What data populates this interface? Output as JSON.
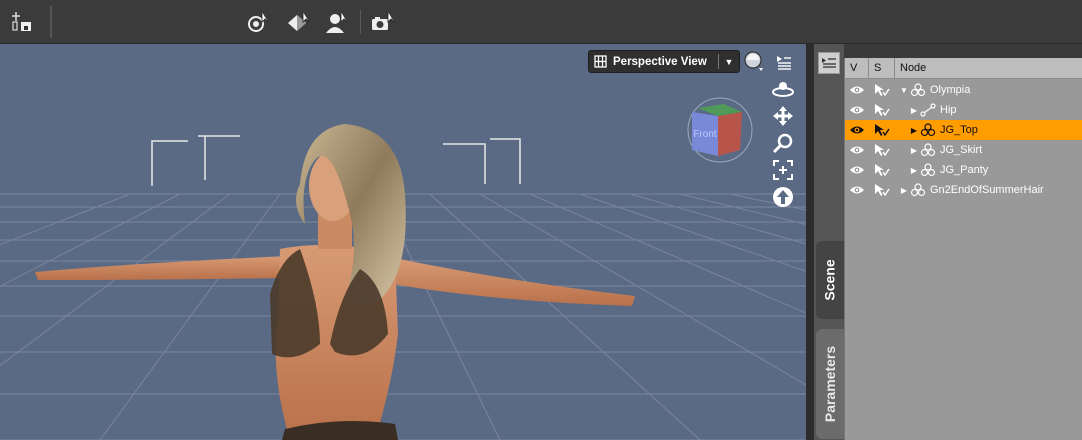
{
  "toolbar": {
    "buttons": [
      {
        "name": "create-node-icon"
      },
      {
        "name": "rotate-tool-icon"
      },
      {
        "name": "surface-tool-icon"
      },
      {
        "name": "figure-tool-icon"
      },
      {
        "name": "render-tool-icon"
      }
    ]
  },
  "viewport": {
    "view_label": "Perspective View",
    "view_dropdown_glyph": "▼",
    "cube_face_label": "Front",
    "background_color": "#5b6a84",
    "tools": [
      "orbit-icon",
      "pan-icon",
      "zoom-icon",
      "frame-icon",
      "reset-view-icon"
    ]
  },
  "side_tabs": {
    "scene": "Scene",
    "parameters": "Parameters"
  },
  "scene_panel": {
    "columns": [
      "V",
      "S",
      "Node"
    ],
    "selected_color": "#ff9c00",
    "rows": [
      {
        "label": "Olympia",
        "depth": 0,
        "expander": "▼",
        "icon": "figure-icon",
        "selected": false
      },
      {
        "label": "Hip",
        "depth": 1,
        "expander": "▶",
        "icon": "bone-icon",
        "selected": false
      },
      {
        "label": "JG_Top",
        "depth": 1,
        "expander": "▶",
        "icon": "figure-icon",
        "selected": true
      },
      {
        "label": "JG_Skirt",
        "depth": 1,
        "expander": "▶",
        "icon": "figure-icon",
        "selected": false
      },
      {
        "label": "JG_Panty",
        "depth": 1,
        "expander": "▶",
        "icon": "figure-icon",
        "selected": false
      },
      {
        "label": "Gn2EndOfSummerHair",
        "depth": 0,
        "expander": "▶",
        "icon": "figure-icon",
        "selected": false
      }
    ]
  }
}
